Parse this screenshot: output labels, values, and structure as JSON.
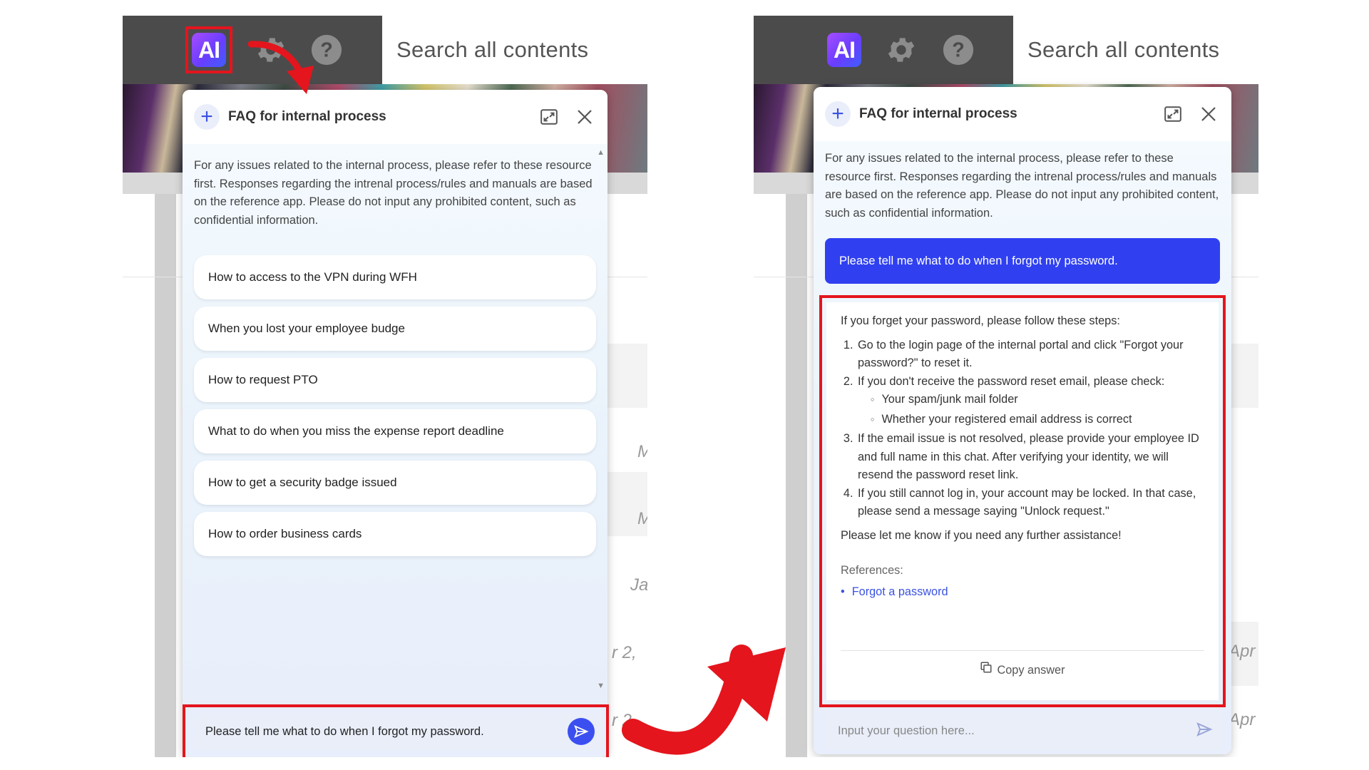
{
  "search_placeholder": "Search all contents",
  "chat_title": "FAQ for internal process",
  "intro_text": "For any issues related to the internal process, please refer to these resource first. Responses regarding the intrenal process/rules and manuals are based on the reference app. Please do not input any prohibited content, such as confidential information.",
  "faq_items": [
    "How to access to the VPN during WFH",
    "When you lost your employee budge",
    "How to request PTO",
    "What to do when you miss the expense report deadline",
    "How to get a security badge issued",
    "How to order business cards"
  ],
  "left_input_value": "Please tell me what to do when I forgot my password.",
  "user_message": "Please tell me what to do when I forgot my password.",
  "answer": {
    "intro": "If you forget your password, please follow these steps:",
    "step1": "Go to the login page of the internal portal and click \"Forgot your password?\" to reset it.",
    "step2": "If you don't receive the password reset email, please check:",
    "step2_sub1": "Your spam/junk mail folder",
    "step2_sub2": "Whether your registered email address is correct",
    "step3": "If the email issue is not resolved, please provide your employee ID and full name in this chat. After verifying your identity, we will resend the password reset link.",
    "step4": "If you still cannot log in, your account may be locked. In that case, please send a message saying \"Unlock request.\"",
    "closing": "Please let me know if you need any further assistance!",
    "references_label": "References:",
    "reference_link": "Forgot a password",
    "copy_label": "Copy answer"
  },
  "right_input_placeholder": "Input your question here...",
  "bg_texts": {
    "l1": "M",
    "l2": "M",
    "l3": "Ja",
    "l4": "r 2,",
    "l5": "r 2",
    "r1": "Apr",
    "r2": "Apr"
  },
  "colors": {
    "highlight": "#e4151d",
    "accent": "#3b4ff0",
    "topbar": "#4b4b4b"
  },
  "icons": [
    "ai-icon",
    "gear-icon",
    "help-icon",
    "plus-icon",
    "expand-icon",
    "close-icon",
    "send-icon",
    "copy-icon"
  ]
}
